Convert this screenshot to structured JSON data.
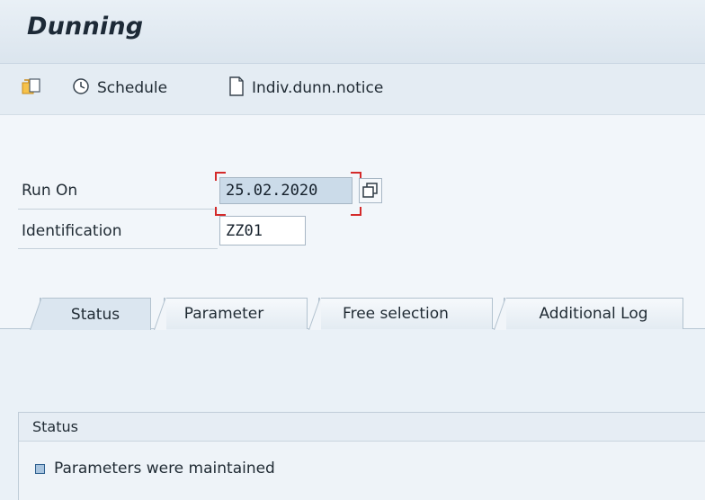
{
  "window": {
    "title": "Dunning"
  },
  "toolbar": {
    "schedule_label": "Schedule",
    "indiv_label": "Indiv.dunn.notice"
  },
  "form": {
    "run_on_label": "Run On",
    "run_on_value": "25.02.2020",
    "identification_label": "Identification",
    "identification_value": "ZZ01"
  },
  "tabs": [
    {
      "label": "Status",
      "active": true
    },
    {
      "label": "Parameter",
      "active": false
    },
    {
      "label": "Free selection",
      "active": false
    },
    {
      "label": "Additional Log",
      "active": false
    }
  ],
  "status": {
    "header": "Status",
    "message": "Parameters were maintained"
  },
  "colors": {
    "accent": "#1d2a37",
    "focus": "#d42a2a",
    "status_bullet": "#a8c4df"
  }
}
